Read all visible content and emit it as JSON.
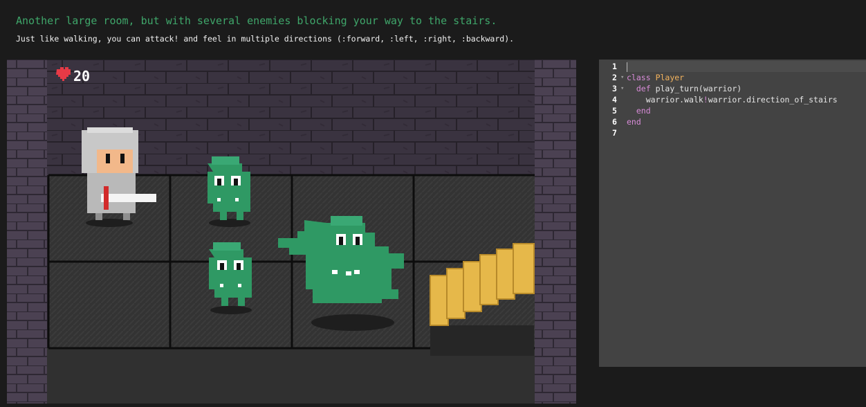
{
  "level": {
    "description": "Another large room, but with several enemies blocking your way to the stairs.",
    "tip": "Just like walking, you can attack! and feel in multiple directions (:forward, :left, :right, :backward)."
  },
  "hud": {
    "health": "20",
    "heart_icon": "heart-icon"
  },
  "colors": {
    "description": "#3fa66a",
    "sludge": "#2f9964",
    "heart": "#e63a46",
    "stairs": "#e6b84a"
  },
  "board": {
    "columns": 4,
    "rows": 2,
    "units": [
      {
        "type": "warrior",
        "cell": [
          0,
          0
        ]
      },
      {
        "type": "sludge",
        "cell": [
          1,
          0
        ]
      },
      {
        "type": "sludge",
        "cell": [
          1,
          1
        ]
      },
      {
        "type": "thick-sludge",
        "cell": [
          2,
          1
        ]
      },
      {
        "type": "stairs",
        "cell": [
          3,
          1
        ]
      }
    ]
  },
  "editor": {
    "line_numbers": [
      "1",
      "2",
      "3",
      "4",
      "5",
      "6",
      "7"
    ],
    "lines": [
      "",
      "class Player",
      "  def play_turn(warrior)",
      "    warrior.walk!warrior.direction_of_stairs",
      "  end",
      "end",
      ""
    ],
    "tokens": {
      "class_kw": "class",
      "class_name": "Player",
      "def_kw": "def",
      "method_sig": "play_turn(warrior)",
      "walk_call": "warrior.walk",
      "bang": "!",
      "walk_arg": "warrior.direction_of_stairs",
      "end_kw": "end"
    },
    "fold_markers": [
      "▾",
      "▾"
    ]
  }
}
